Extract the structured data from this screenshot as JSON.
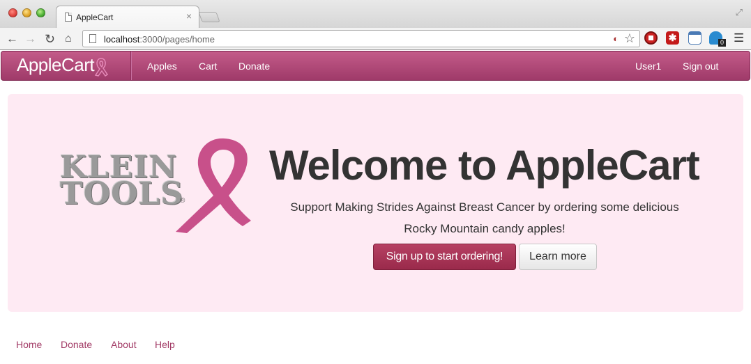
{
  "browser": {
    "tab_title": "AppleCart",
    "tab_close": "×",
    "url_host": "localhost",
    "url_path": ":3000/pages/home",
    "extension_badge": "0"
  },
  "navbar": {
    "brand": "AppleCart",
    "links": [
      "Apples",
      "Cart",
      "Donate"
    ],
    "user": "User1",
    "signout": "Sign out"
  },
  "hero": {
    "logo_line1": "KLEIN",
    "logo_line2": "TOOLS",
    "logo_reg": "®",
    "title": "Welcome to AppleCart",
    "subtitle_line1": "Support Making Strides Against Breast Cancer by ordering some delicious",
    "subtitle_line2": "Rocky Mountain candy apples!",
    "primary_button": "Sign up to start ordering!",
    "secondary_button": "Learn more"
  },
  "footer": {
    "links": [
      "Home",
      "Donate",
      "About",
      "Help"
    ]
  },
  "colors": {
    "navbar": "#b04a7a",
    "hero_bg": "#feeaf3",
    "primary_button": "#a8334f",
    "ribbon": "#c8508a",
    "footer_link": "#a23b66"
  }
}
